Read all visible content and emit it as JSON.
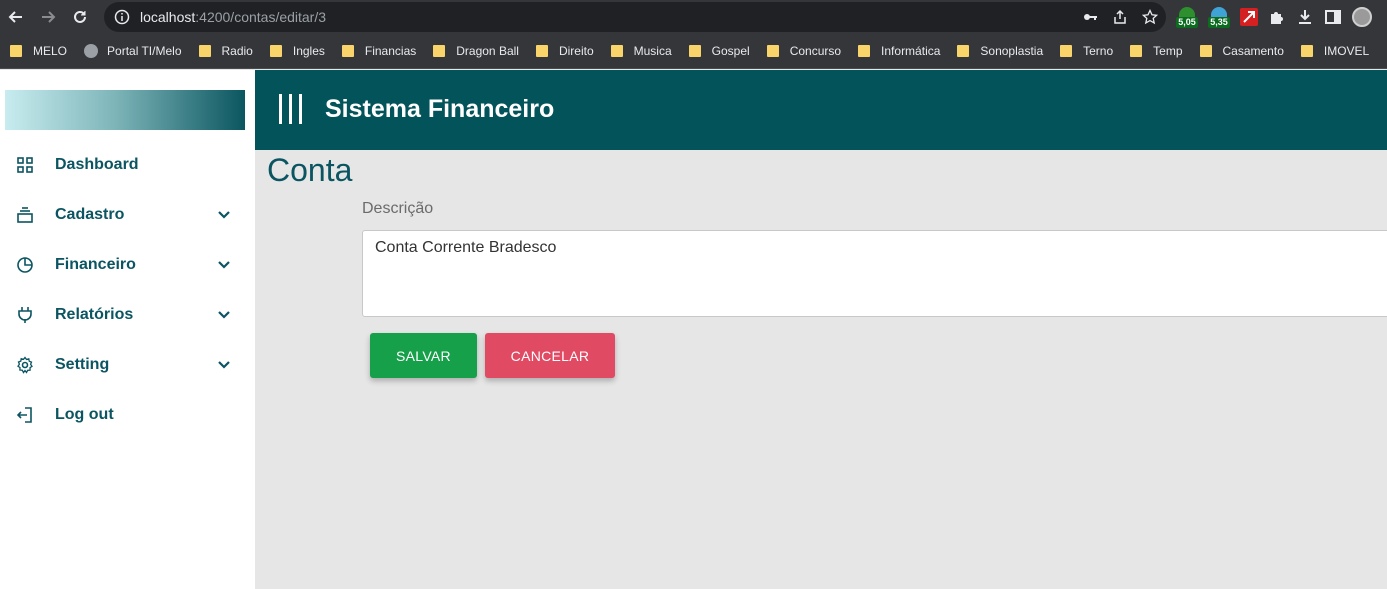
{
  "browser": {
    "url_host": "localhost",
    "url_path": ":4200/contas/editar/3",
    "extensions": [
      {
        "name": "weather-ext-1",
        "label": "5,05",
        "color": "#2e8f2e"
      },
      {
        "name": "weather-ext-2",
        "label": "5,35",
        "color": "#3fa3d6"
      }
    ],
    "bookmarks": [
      {
        "label": "MELO",
        "icon": "folder"
      },
      {
        "label": "Portal TI/Melo",
        "icon": "globe"
      },
      {
        "label": "Radio",
        "icon": "folder"
      },
      {
        "label": "Ingles",
        "icon": "folder"
      },
      {
        "label": "Financias",
        "icon": "folder"
      },
      {
        "label": "Dragon Ball",
        "icon": "folder"
      },
      {
        "label": "Direito",
        "icon": "folder"
      },
      {
        "label": "Musica",
        "icon": "folder"
      },
      {
        "label": "Gospel",
        "icon": "folder"
      },
      {
        "label": "Concurso",
        "icon": "folder"
      },
      {
        "label": "Informática",
        "icon": "folder"
      },
      {
        "label": "Sonoplastia",
        "icon": "folder"
      },
      {
        "label": "Terno",
        "icon": "folder"
      },
      {
        "label": "Temp",
        "icon": "folder"
      },
      {
        "label": "Casamento",
        "icon": "folder"
      },
      {
        "label": "IMOVEL",
        "icon": "folder"
      }
    ]
  },
  "sidebar": {
    "items": [
      {
        "label": "Dashboard",
        "icon": "grid-icon",
        "expandable": false
      },
      {
        "label": "Cadastro",
        "icon": "stack-icon",
        "expandable": true
      },
      {
        "label": "Financeiro",
        "icon": "pie-chart-icon",
        "expandable": true
      },
      {
        "label": "Relatórios",
        "icon": "plug-icon",
        "expandable": true
      },
      {
        "label": "Setting",
        "icon": "gear-icon",
        "expandable": true
      },
      {
        "label": "Log out",
        "icon": "logout-icon",
        "expandable": false
      }
    ]
  },
  "header": {
    "title": "Sistema Financeiro"
  },
  "form": {
    "page_title": "Conta",
    "description_label": "Descrição",
    "description_value": "Conta Corrente Bradesco",
    "save_label": "SALVAR",
    "cancel_label": "CANCELAR"
  },
  "colors": {
    "header_bg": "#02535a",
    "accent_text": "#0b5562",
    "save": "#15a049",
    "cancel": "#e04a63"
  }
}
